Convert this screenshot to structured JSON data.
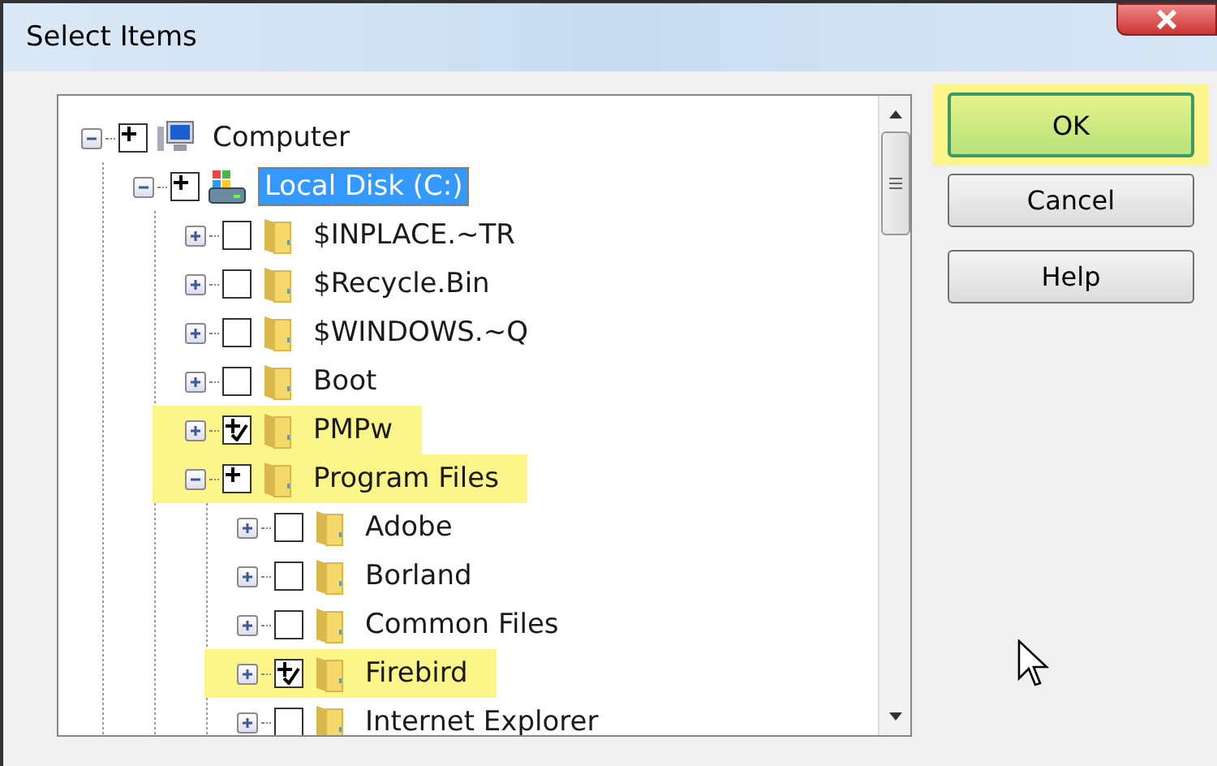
{
  "window": {
    "title": "Select Items"
  },
  "tree": [
    {
      "label": "Computer",
      "kind": "computer",
      "expanded": true,
      "checked": false,
      "partial": true,
      "selected": false,
      "highlighted": false,
      "children": [
        {
          "label": "Local Disk (C:)",
          "kind": "drive",
          "expanded": true,
          "checked": false,
          "partial": true,
          "selected": true,
          "highlighted": false,
          "children": [
            {
              "label": "$INPLACE.~TR",
              "kind": "folder",
              "expanded": false,
              "checked": false,
              "partial": false,
              "selected": false,
              "highlighted": false
            },
            {
              "label": "$Recycle.Bin",
              "kind": "folder",
              "expanded": false,
              "checked": false,
              "partial": false,
              "selected": false,
              "highlighted": false
            },
            {
              "label": "$WINDOWS.~Q",
              "kind": "folder",
              "expanded": false,
              "checked": false,
              "partial": false,
              "selected": false,
              "highlighted": false
            },
            {
              "label": "Boot",
              "kind": "folder",
              "expanded": false,
              "checked": false,
              "partial": false,
              "selected": false,
              "highlighted": false
            },
            {
              "label": "PMPw",
              "kind": "folder",
              "expanded": false,
              "checked": true,
              "partial": true,
              "selected": false,
              "highlighted": true
            },
            {
              "label": "Program Files",
              "kind": "folder",
              "expanded": true,
              "checked": false,
              "partial": true,
              "selected": false,
              "highlighted": true,
              "children": [
                {
                  "label": "Adobe",
                  "kind": "folder",
                  "expanded": false,
                  "checked": false,
                  "partial": false,
                  "selected": false,
                  "highlighted": false
                },
                {
                  "label": "Borland",
                  "kind": "folder",
                  "expanded": false,
                  "checked": false,
                  "partial": false,
                  "selected": false,
                  "highlighted": false
                },
                {
                  "label": "Common Files",
                  "kind": "folder",
                  "expanded": false,
                  "checked": false,
                  "partial": false,
                  "selected": false,
                  "highlighted": false
                },
                {
                  "label": "Firebird",
                  "kind": "folder",
                  "expanded": false,
                  "checked": true,
                  "partial": true,
                  "selected": false,
                  "highlighted": true
                },
                {
                  "label": "Internet Explorer",
                  "kind": "folder",
                  "expanded": false,
                  "checked": false,
                  "partial": false,
                  "selected": false,
                  "highlighted": false
                }
              ]
            }
          ]
        }
      ]
    }
  ],
  "buttons": [
    {
      "label": "OK",
      "default": true,
      "highlighted": true
    },
    {
      "label": "Cancel",
      "default": false,
      "highlighted": false
    },
    {
      "label": "Help",
      "default": false,
      "highlighted": false
    }
  ]
}
